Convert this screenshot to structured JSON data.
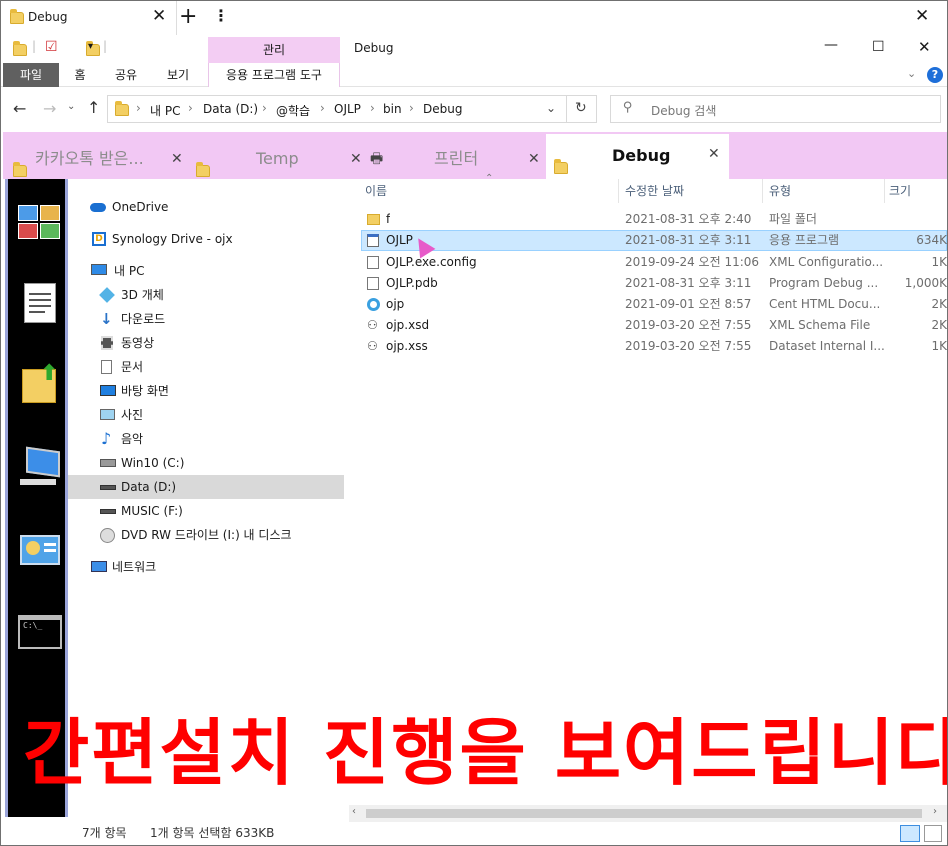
{
  "outer_tab": {
    "title": "Debug"
  },
  "ribbon": {
    "context_group": "관리",
    "window_title": "Debug",
    "tabs": [
      "파일",
      "홈",
      "공유",
      "보기"
    ],
    "context_tab": "응용 프로그램 도구"
  },
  "address": {
    "breadcrumb": [
      "내 PC",
      "Data (D:)",
      "@학습",
      "OJLP",
      "bin",
      "Debug"
    ],
    "search_placeholder": "Debug 검색"
  },
  "inner_tabs": [
    {
      "label": "카카오톡 받은...",
      "active": false
    },
    {
      "label": "Temp",
      "active": false
    },
    {
      "label": "프린터",
      "active": false
    },
    {
      "label": "Debug",
      "active": true
    }
  ],
  "nav": {
    "items": [
      {
        "label": "OneDrive"
      },
      {
        "label": "Synology Drive - ojx"
      },
      {
        "label": "내 PC"
      },
      {
        "label": "3D 개체"
      },
      {
        "label": "다운로드"
      },
      {
        "label": "동영상"
      },
      {
        "label": "문서"
      },
      {
        "label": "바탕 화면"
      },
      {
        "label": "사진"
      },
      {
        "label": "음악"
      },
      {
        "label": "Win10 (C:)"
      },
      {
        "label": "Data (D:)"
      },
      {
        "label": "MUSIC (F:)"
      },
      {
        "label": "DVD RW 드라이브 (I:) 내 디스크"
      },
      {
        "label": "네트워크"
      }
    ]
  },
  "files": {
    "columns": [
      "이름",
      "수정한 날짜",
      "유형",
      "크기"
    ],
    "rows": [
      {
        "name": "f",
        "date": "2021-08-31 오후 2:40",
        "type": "파일 폴더",
        "size": ""
      },
      {
        "name": "OJLP",
        "date": "2021-08-31 오후 3:11",
        "type": "응용 프로그램",
        "size": "634K"
      },
      {
        "name": "OJLP.exe.config",
        "date": "2019-09-24 오전 11:06",
        "type": "XML Configuratio...",
        "size": "1K"
      },
      {
        "name": "OJLP.pdb",
        "date": "2021-08-31 오후 3:11",
        "type": "Program Debug ...",
        "size": "1,000K"
      },
      {
        "name": "ojp",
        "date": "2021-09-01 오전 8:57",
        "type": "Cent HTML Docu...",
        "size": "2K"
      },
      {
        "name": "ojp.xsd",
        "date": "2019-03-20 오전 7:55",
        "type": "XML Schema File",
        "size": "2K"
      },
      {
        "name": "ojp.xss",
        "date": "2019-03-20 오전 7:55",
        "type": "Dataset Internal I...",
        "size": "1K"
      }
    ]
  },
  "status": {
    "count": "7개 항목",
    "selection": "1개 항목 선택함 633KB"
  },
  "overlay": {
    "text": "간편설치 진행을 보여드립니다."
  }
}
